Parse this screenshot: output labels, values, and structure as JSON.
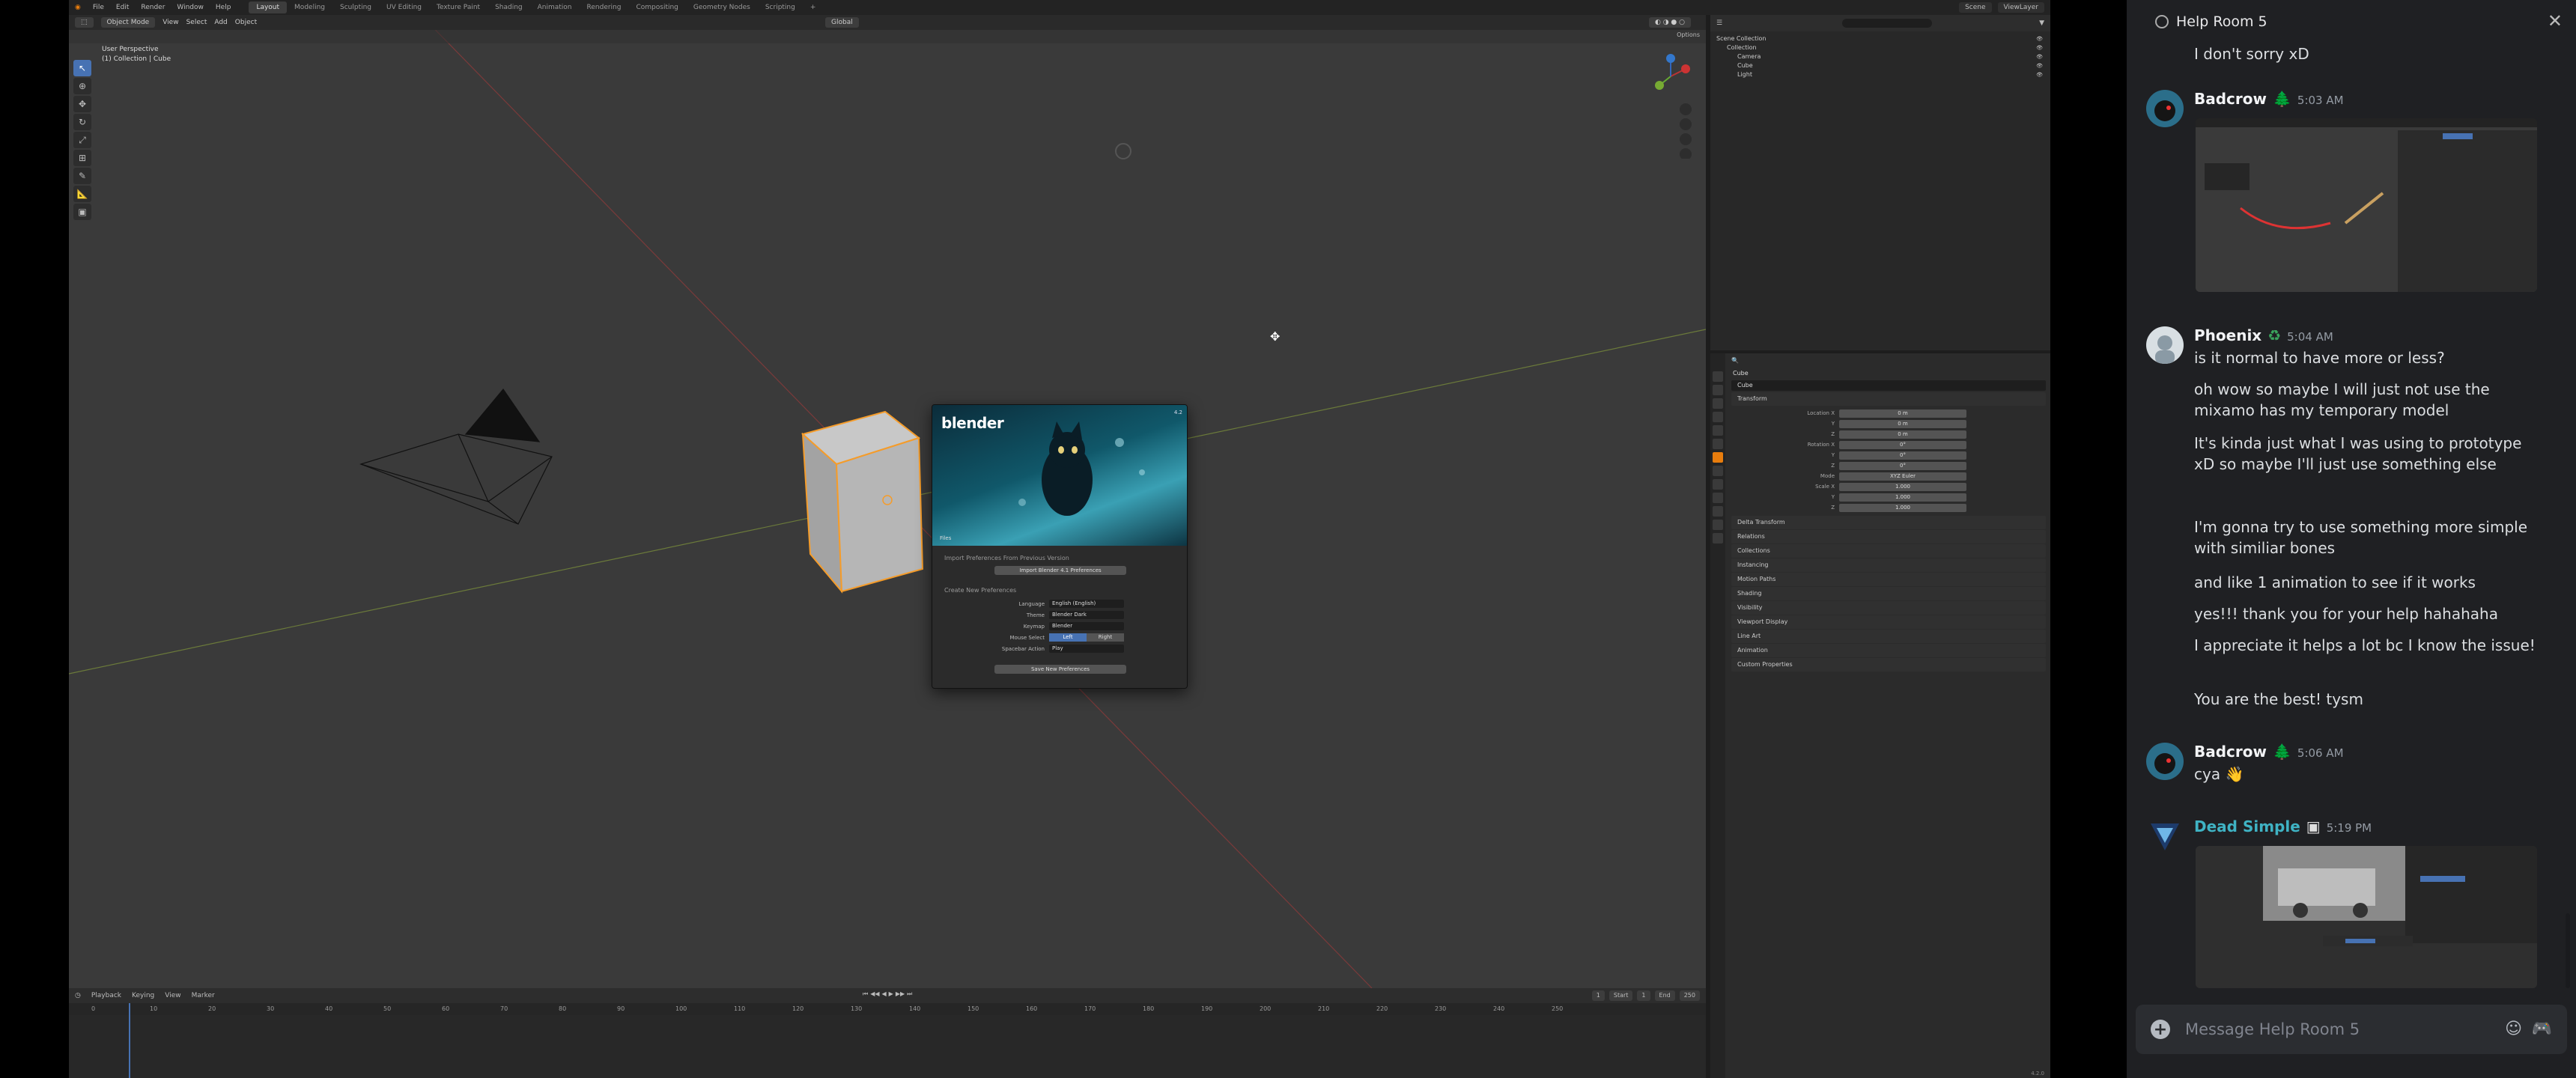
{
  "blender": {
    "menus": [
      "File",
      "Edit",
      "Render",
      "Window",
      "Help"
    ],
    "workspaces": [
      "Layout",
      "Modeling",
      "Sculpting",
      "UV Editing",
      "Texture Paint",
      "Shading",
      "Animation",
      "Rendering",
      "Compositing",
      "Geometry Nodes",
      "Scripting"
    ],
    "active_workspace": "Layout",
    "scene_label": "Scene",
    "viewlayer_label": "ViewLayer",
    "viewport_header": {
      "mode": "Object Mode",
      "menus": [
        "View",
        "Select",
        "Add",
        "Object"
      ],
      "transform": "Global",
      "options": "Options"
    },
    "viewport_info": {
      "line1": "User Perspective",
      "line2": "(1) Collection | Cube"
    },
    "splash": {
      "logo": "blender",
      "version": "4.2",
      "section_file": "Files",
      "import_heading": "Import Preferences From Previous Version",
      "import_button": "Import Blender 4.1 Preferences",
      "create_heading": "Create New Preferences",
      "rows": [
        {
          "label": "Language",
          "value": "English (English)"
        },
        {
          "label": "Theme",
          "value": "Blender Dark"
        },
        {
          "label": "Keymap",
          "value": "Blender"
        }
      ],
      "mouse_select_label": "Mouse Select",
      "mouse_select_left": "Left",
      "mouse_select_right": "Right",
      "spacebar_label": "Spacebar Action",
      "spacebar_value": "Play",
      "save_button": "Save New Preferences"
    },
    "timeline": {
      "menus": [
        "Playback",
        "Keying",
        "View",
        "Marker"
      ],
      "current_frame": "1",
      "start_label": "Start",
      "start": "1",
      "end_label": "End",
      "end": "250",
      "ruler": [
        "0",
        "10",
        "20",
        "30",
        "40",
        "50",
        "60",
        "70",
        "80",
        "90",
        "100",
        "110",
        "120",
        "130",
        "140",
        "150",
        "160",
        "170",
        "180",
        "190",
        "200",
        "210",
        "220",
        "230",
        "240",
        "250"
      ]
    },
    "outliner": {
      "search_placeholder": "",
      "items": [
        {
          "label": "Scene Collection",
          "indent": 0
        },
        {
          "label": "Collection",
          "indent": 1
        },
        {
          "label": "Camera",
          "indent": 2
        },
        {
          "label": "Cube",
          "indent": 2
        },
        {
          "label": "Light",
          "indent": 2
        }
      ]
    },
    "properties": {
      "object_name": "Cube",
      "object_field": "Cube",
      "transform_panel": "Transform",
      "fields": [
        {
          "label": "Location X",
          "value": "0 m"
        },
        {
          "label": "Y",
          "value": "0 m"
        },
        {
          "label": "Z",
          "value": "0 m"
        },
        {
          "label": "Rotation X",
          "value": "0°"
        },
        {
          "label": "Y",
          "value": "0°"
        },
        {
          "label": "Z",
          "value": "0°"
        },
        {
          "label": "Mode",
          "value": "XYZ Euler"
        },
        {
          "label": "Scale X",
          "value": "1.000"
        },
        {
          "label": "Y",
          "value": "1.000"
        },
        {
          "label": "Z",
          "value": "1.000"
        }
      ],
      "panels": [
        "Delta Transform",
        "Relations",
        "Collections",
        "Instancing",
        "Motion Paths",
        "Shading",
        "Visibility",
        "Viewport Display",
        "Line Art",
        "Animation",
        "Custom Properties"
      ]
    },
    "status_version": "4.2.0"
  },
  "discord": {
    "channel": "Help Room 5",
    "input_placeholder": "Message Help Room 5",
    "top_line": "I don't sorry xD",
    "groups": [
      {
        "author": "Badcrow",
        "badge": "🌲",
        "time": "5:03 AM",
        "name_color": "#f2f3f5",
        "lines": [],
        "has_image": true
      },
      {
        "author": "Phoenix",
        "badge": "♻",
        "time": "5:04 AM",
        "name_color": "#f2f3f5",
        "lines": [
          "is it normal to have more or less?",
          "oh wow so maybe I will just not use the mixamo has my temporary model",
          "It's kinda just what I was using to prototype xD so maybe I'll just use something else",
          "I'm gonna try to use something more simple with similiar bones",
          "and like 1 animation to see if it works",
          "yes!!! thank you for your help hahahaha",
          "I appreciate it helps a lot bc I know the issue!",
          "You are the best! tysm"
        ]
      },
      {
        "author": "Badcrow",
        "badge": "🌲",
        "time": "5:06 AM",
        "name_color": "#f2f3f5",
        "lines": [
          "cya 👋"
        ]
      },
      {
        "author": "Dead Simple",
        "badge": "▣",
        "time": "5:19 PM",
        "name_color": "#3fb3c4",
        "lines": [],
        "has_image": true
      }
    ]
  },
  "colors": {
    "blender_accent": "#4772b3",
    "selection_orange": "#f59c2a",
    "discord_bg": "#1f2023",
    "dead_simple_name": "#3fb3c4"
  }
}
